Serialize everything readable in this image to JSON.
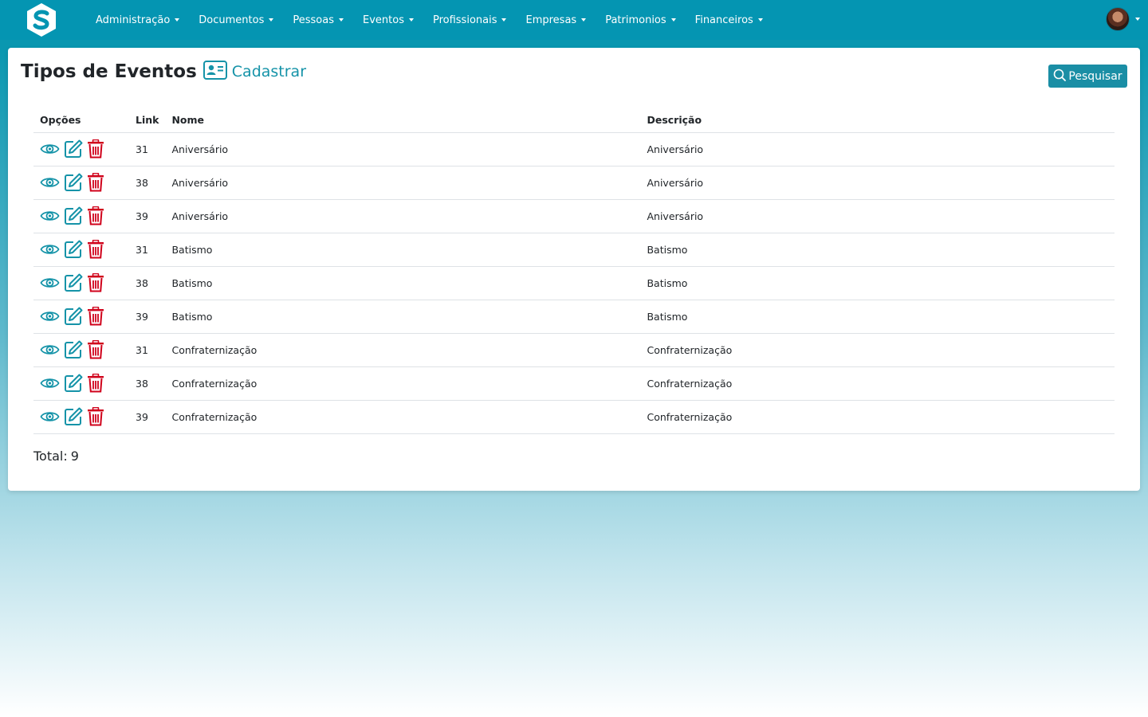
{
  "nav": {
    "items": [
      {
        "label": "Administração"
      },
      {
        "label": "Documentos"
      },
      {
        "label": "Pessoas"
      },
      {
        "label": "Eventos"
      },
      {
        "label": "Profissionais"
      },
      {
        "label": "Empresas"
      },
      {
        "label": "Patrimonios"
      },
      {
        "label": "Financeiros"
      }
    ],
    "logo_icon": "s-shield-logo",
    "avatar_icon": "user-avatar"
  },
  "page": {
    "title": "Tipos de Eventos",
    "register_label": "Cadastrar",
    "search_label": "Pesquisar"
  },
  "table": {
    "headers": {
      "options": "Opções",
      "link": "Link",
      "nome": "Nome",
      "descricao": "Descrição"
    },
    "rows": [
      {
        "link": "31",
        "nome": "Aniversário",
        "descricao": "Aniversário"
      },
      {
        "link": "38",
        "nome": "Aniversário",
        "descricao": "Aniversário"
      },
      {
        "link": "39",
        "nome": "Aniversário",
        "descricao": "Aniversário"
      },
      {
        "link": "31",
        "nome": "Batismo",
        "descricao": "Batismo"
      },
      {
        "link": "38",
        "nome": "Batismo",
        "descricao": "Batismo"
      },
      {
        "link": "39",
        "nome": "Batismo",
        "descricao": "Batismo"
      },
      {
        "link": "31",
        "nome": "Confraternização",
        "descricao": "Confraternização"
      },
      {
        "link": "38",
        "nome": "Confraternização",
        "descricao": "Confraternização"
      },
      {
        "link": "39",
        "nome": "Confraternização",
        "descricao": "Confraternização"
      }
    ]
  },
  "footer": {
    "total_label": "Total:",
    "total_value": "9"
  },
  "colors": {
    "primary": "#0495b2",
    "accent": "#1593a8",
    "danger": "#d0021b"
  }
}
